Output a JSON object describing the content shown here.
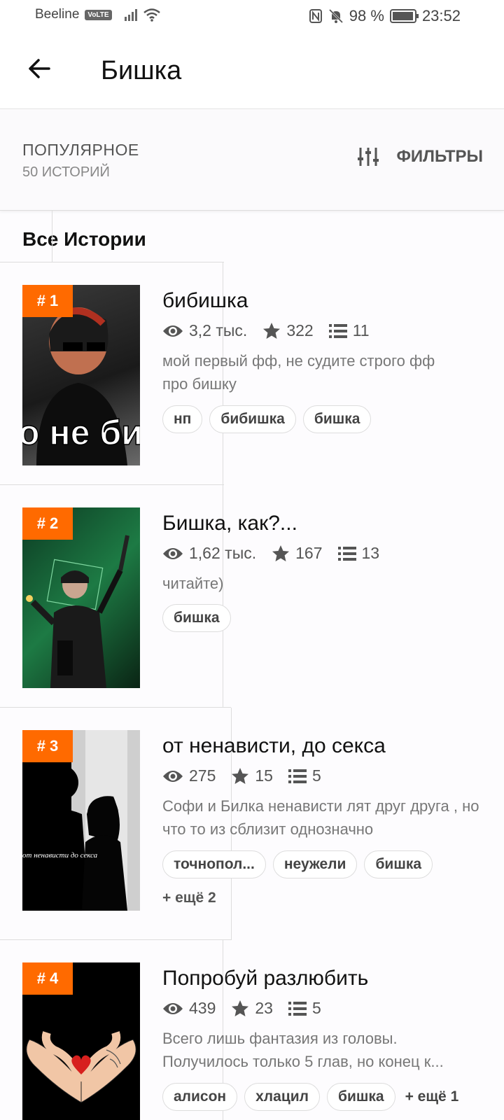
{
  "status_bar": {
    "carrier": "Beeline",
    "volte": "VoLTE",
    "battery_percent": "98 %",
    "battery_level": 0.98,
    "time": "23:52"
  },
  "app_bar": {
    "title": "Бишка"
  },
  "sort": {
    "title": "ПОПУЛЯРНОЕ",
    "subtitle": "50 ИСТОРИЙ",
    "filters_label": "ФИЛЬТРЫ"
  },
  "section": {
    "title": "Все Истории"
  },
  "stories": [
    {
      "rank": "# 1",
      "title": "бибишка",
      "views": "3,2 тыс.",
      "votes": "322",
      "parts": "11",
      "description": "мой первый фф, не судите строго фф про бишку",
      "tags": [
        "нп",
        "бибишка",
        "бишка"
      ],
      "more": "",
      "cover_text": "о не биш",
      "cover_colors": [
        "#2a2a2a",
        "#b04020"
      ]
    },
    {
      "rank": "# 2",
      "title": "Бишка, как?...",
      "views": "1,62 тыс.",
      "votes": "167",
      "parts": "13",
      "description": "читайте)",
      "tags": [
        "бишка"
      ],
      "more": "",
      "cover_text": "",
      "cover_colors": [
        "#0f4a2a",
        "#1c7a40"
      ]
    },
    {
      "rank": "# 3",
      "title": "от ненависти, до секса",
      "views": "275",
      "votes": "15",
      "parts": "5",
      "description": "Софи и Билка ненависти лят друг друга , но что то из сблизит однозначно",
      "tags": [
        "точнопол...",
        "неужели",
        "бишка"
      ],
      "more": "+ ещё 2",
      "cover_text": "от ненависти   до секса",
      "cover_colors": [
        "#000000",
        "#d8d8d8"
      ]
    },
    {
      "rank": "# 4",
      "title": "Попробуй разлюбить",
      "views": "439",
      "votes": "23",
      "parts": "5",
      "description": "Всего лишь фантазия из головы. Получилось только 5 глав, но конец к...",
      "tags": [
        "алисон",
        "хлацил",
        "бишка"
      ],
      "more": "+ ещё 1",
      "cover_text": "",
      "cover_colors": [
        "#000000",
        "#f0c0a0"
      ]
    }
  ]
}
